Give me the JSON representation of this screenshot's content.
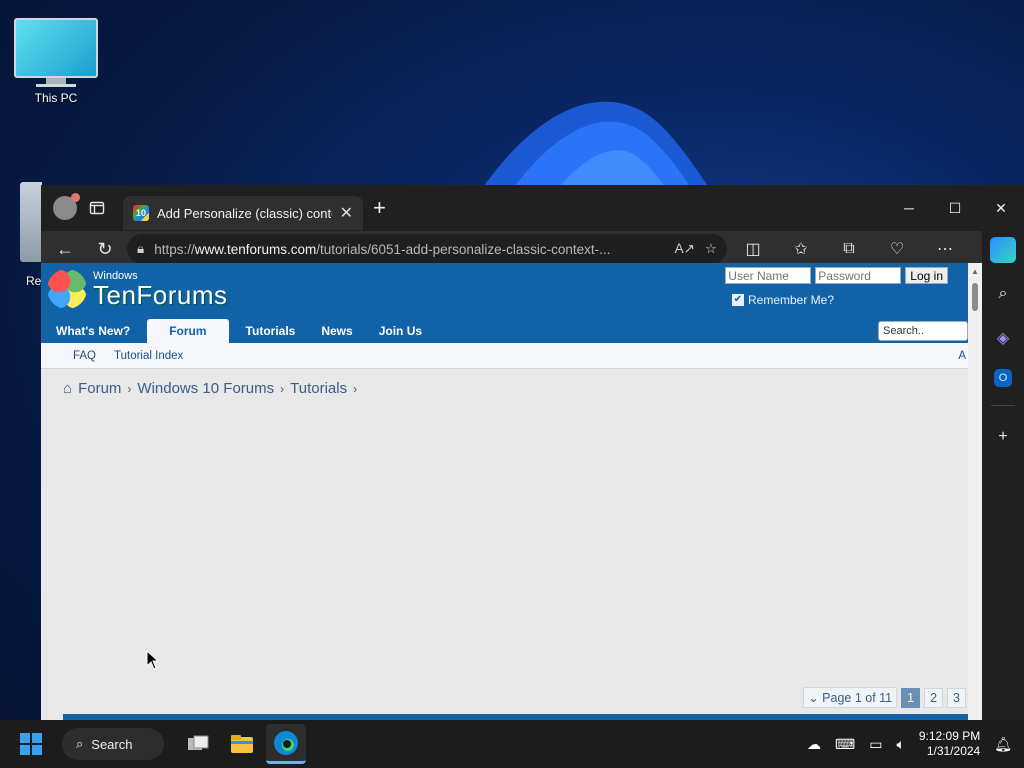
{
  "desktop": {
    "icons": [
      {
        "label": "This PC"
      },
      {
        "label": "Re"
      }
    ]
  },
  "browser": {
    "tab_title": "Add Personalize (classic) context",
    "tab_favicon_text": "10",
    "url_domain": "www.tenforums.com",
    "url_prefix": "https://",
    "url_path": "/tutorials/6051-add-personalize-classic-context-...",
    "window_controls": {
      "minimize": "─",
      "maximize": "☐",
      "close": "✕"
    }
  },
  "site": {
    "logo_small": "Windows",
    "logo_big": "TenForums",
    "login": {
      "username_placeholder": "User Name",
      "password_placeholder": "Password",
      "login_button": "Log in",
      "remember_label": "Remember Me?"
    },
    "nav": [
      "What's New?",
      "Forum",
      "Tutorials",
      "News",
      "Join Us"
    ],
    "search_placeholder": "Search..",
    "subnav": [
      "FAQ",
      "Tutorial Index"
    ],
    "subnav_right": "A",
    "breadcrumb": [
      "Forum",
      "Windows 10 Forums",
      "Tutorials"
    ],
    "pager": {
      "label": "Page 1 of 11",
      "pages": [
        "1",
        "2",
        "3"
      ]
    }
  },
  "taskbar": {
    "search_label": "Search",
    "time": "9:12:09 PM",
    "date": "1/31/2024"
  },
  "colors": {
    "site_blue": "#1262a8",
    "page_bg": "#e8e8e8",
    "taskbar_bg": "#1c1c1c"
  }
}
